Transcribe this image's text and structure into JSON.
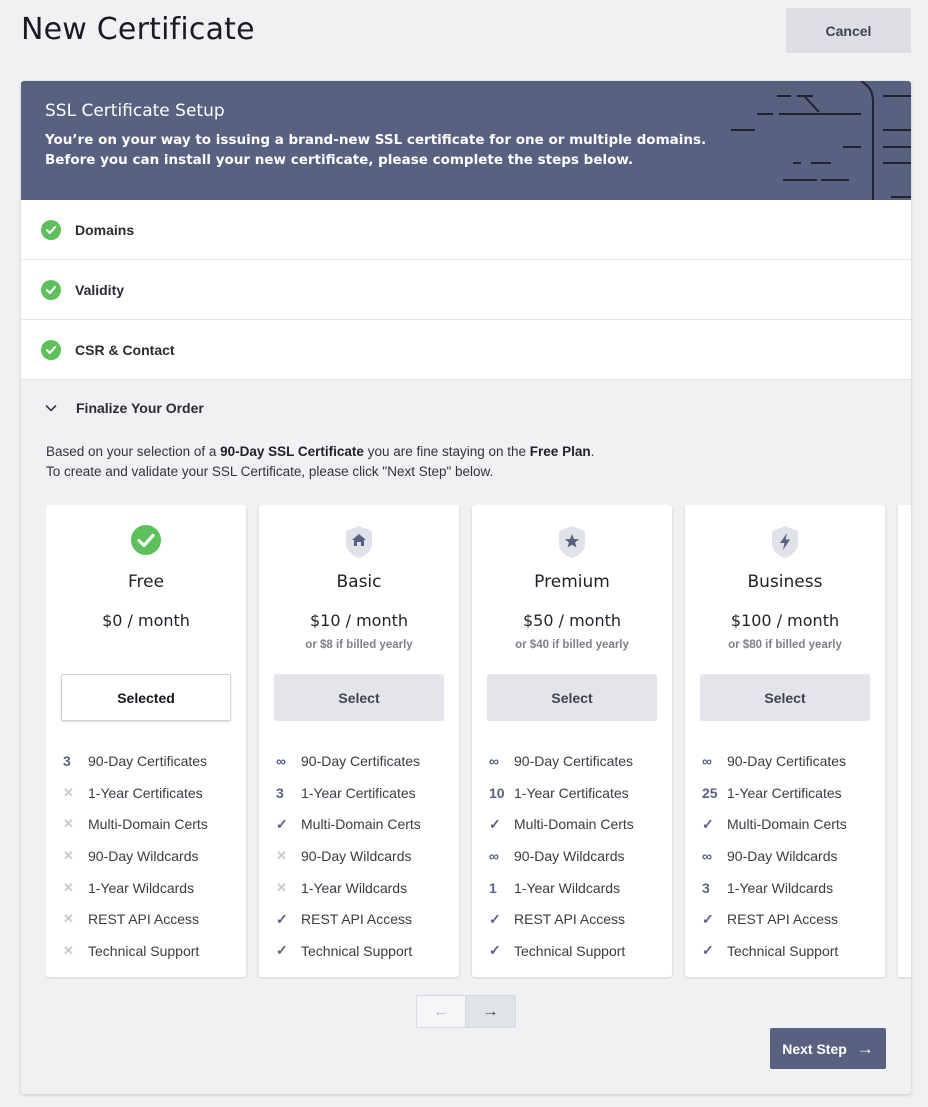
{
  "page": {
    "title": "New Certificate",
    "cancel_label": "Cancel"
  },
  "banner": {
    "title": "SSL Certificate Setup",
    "line1": "You’re on your way to issuing a brand-new SSL certificate for one or multiple domains.",
    "line2": "Before you can install your new certificate, please complete the steps below."
  },
  "steps": [
    {
      "label": "Domains",
      "icon": "check-circle-icon"
    },
    {
      "label": "Validity",
      "icon": "check-circle-icon"
    },
    {
      "label": "CSR & Contact",
      "icon": "check-circle-icon"
    }
  ],
  "finalize": {
    "label": "Finalize Your Order",
    "desc_a": "Based on your selection of a ",
    "desc_b": "90-Day SSL Certificate",
    "desc_c": " you are fine staying on the ",
    "desc_d": "Free Plan",
    "desc_e": ".",
    "desc_line2": "To create and validate your SSL Certificate, please click \"Next Step\" below."
  },
  "plans": [
    {
      "name": "Free",
      "price": "$0 / month",
      "yearly": "",
      "button": "Selected",
      "selected": true,
      "icon": "check-circle-icon",
      "features": [
        {
          "mark": "3",
          "label": "90-Day Certificates"
        },
        {
          "mark": "✕",
          "label": "1-Year Certificates"
        },
        {
          "mark": "✕",
          "label": "Multi-Domain Certs"
        },
        {
          "mark": "✕",
          "label": "90-Day Wildcards"
        },
        {
          "mark": "✕",
          "label": "1-Year Wildcards"
        },
        {
          "mark": "✕",
          "label": "REST API Access"
        },
        {
          "mark": "✕",
          "label": "Technical Support"
        }
      ]
    },
    {
      "name": "Basic",
      "price": "$10 / month",
      "yearly": "or $8 if billed yearly",
      "button": "Select",
      "selected": false,
      "icon": "home-shield-icon",
      "features": [
        {
          "mark": "∞",
          "label": "90-Day Certificates"
        },
        {
          "mark": "3",
          "label": "1-Year Certificates"
        },
        {
          "mark": "✓",
          "label": "Multi-Domain Certs"
        },
        {
          "mark": "✕",
          "label": "90-Day Wildcards"
        },
        {
          "mark": "✕",
          "label": "1-Year Wildcards"
        },
        {
          "mark": "✓",
          "label": "REST API Access"
        },
        {
          "mark": "✓",
          "label": "Technical Support"
        }
      ]
    },
    {
      "name": "Premium",
      "price": "$50 / month",
      "yearly": "or $40 if billed yearly",
      "button": "Select",
      "selected": false,
      "icon": "star-shield-icon",
      "features": [
        {
          "mark": "∞",
          "label": "90-Day Certificates"
        },
        {
          "mark": "10",
          "label": "1-Year Certificates"
        },
        {
          "mark": "✓",
          "label": "Multi-Domain Certs"
        },
        {
          "mark": "∞",
          "label": "90-Day Wildcards"
        },
        {
          "mark": "1",
          "label": "1-Year Wildcards"
        },
        {
          "mark": "✓",
          "label": "REST API Access"
        },
        {
          "mark": "✓",
          "label": "Technical Support"
        }
      ]
    },
    {
      "name": "Business",
      "price": "$100 / month",
      "yearly": "or $80 if billed yearly",
      "button": "Select",
      "selected": false,
      "icon": "bolt-shield-icon",
      "features": [
        {
          "mark": "∞",
          "label": "90-Day Certificates"
        },
        {
          "mark": "25",
          "label": "1-Year Certificates"
        },
        {
          "mark": "✓",
          "label": "Multi-Domain Certs"
        },
        {
          "mark": "∞",
          "label": "90-Day Wildcards"
        },
        {
          "mark": "3",
          "label": "1-Year Wildcards"
        },
        {
          "mark": "✓",
          "label": "REST API Access"
        },
        {
          "mark": "✓",
          "label": "Technical Support"
        }
      ]
    }
  ],
  "pager": {
    "prev": "←",
    "next": "→"
  },
  "next_step": {
    "label": "Next Step",
    "arrow": "→"
  },
  "colors": {
    "accent": "#586180",
    "success": "#5cc15b",
    "background": "#f0f1f3"
  }
}
